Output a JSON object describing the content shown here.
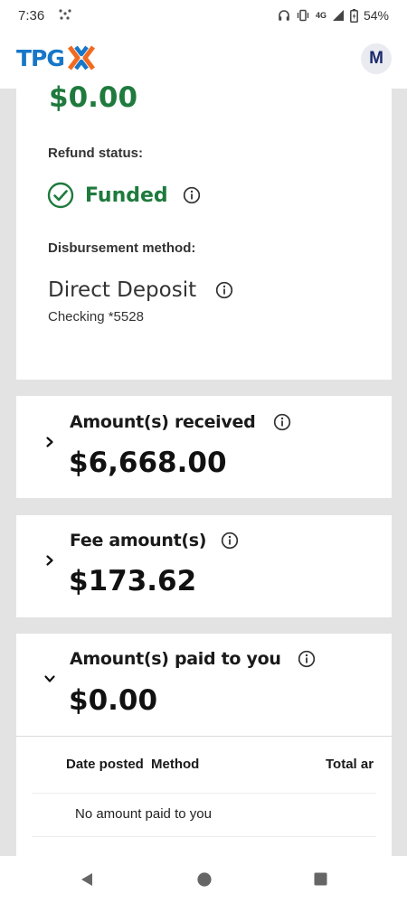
{
  "status_bar": {
    "time": "7:36",
    "network": "4G",
    "battery": "54%"
  },
  "header": {
    "logo_text": "TPG",
    "avatar_initial": "M",
    "brand_blue": "#1677c8",
    "brand_orange": "#f26a21"
  },
  "refund": {
    "top_amount": "$0.00",
    "status_label": "Refund status:",
    "status_value": "Funded",
    "method_label": "Disbursement method:",
    "method_value": "Direct Deposit",
    "account": "Checking *5528",
    "status_color": "#1f7a3d"
  },
  "cards": {
    "received": {
      "title": "Amount(s) received",
      "amount": "$6,668.00",
      "expanded": false
    },
    "fee": {
      "title": "Fee amount(s)",
      "amount": "$173.62",
      "expanded": false
    },
    "paid": {
      "title": "Amount(s) paid to you",
      "amount": "$0.00",
      "expanded": true
    }
  },
  "paid_table": {
    "columns": [
      "Date posted",
      "Method",
      "Total ar"
    ],
    "empty_message": "No amount paid to you"
  },
  "icons": {
    "info": "info-icon",
    "check": "check-circle-icon",
    "chevron_right": "chevron-right-icon",
    "chevron_down": "chevron-down-icon",
    "back": "back-triangle-icon",
    "home": "home-circle-icon",
    "recents": "recents-square-icon"
  }
}
